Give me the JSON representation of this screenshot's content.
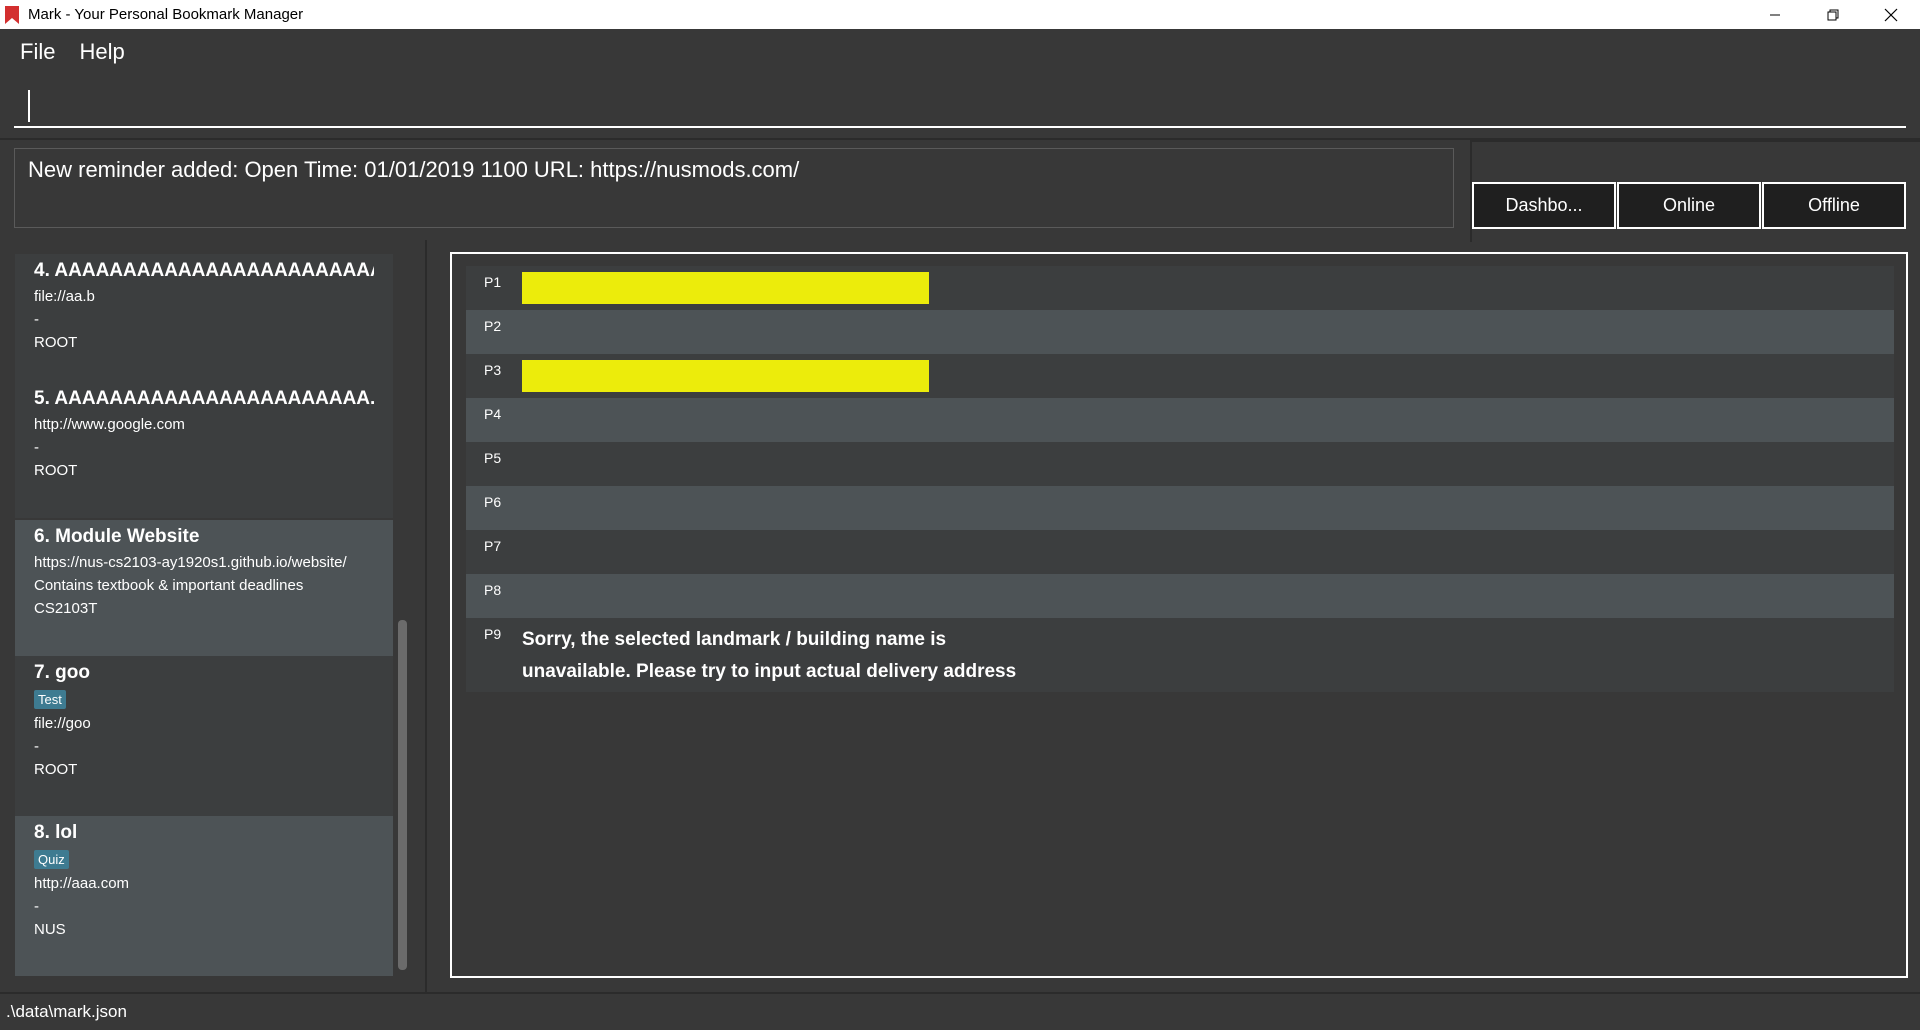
{
  "window": {
    "title": "Mark - Your Personal Bookmark Manager"
  },
  "menu": {
    "file": "File",
    "help": "Help"
  },
  "command": {
    "value": ""
  },
  "result": {
    "text": "New reminder added: Open Time: 01/01/2019 1100 URL: https://nusmods.com/"
  },
  "tabs": {
    "dashboard": "Dashbo...",
    "online": "Online",
    "offline": "Offline"
  },
  "bookmarks": [
    {
      "title": "4.  AAAAAAAAAAAAAAAAAAAAAAAA",
      "url": "file://aa.b",
      "remark": "-",
      "folder": "ROOT"
    },
    {
      "title": "5.  AAAAAAAAAAAAAAAAAAAAAAA...",
      "url": "http://www.google.com",
      "remark": "-",
      "folder": "ROOT"
    },
    {
      "title": "6.  Module Website",
      "url": "https://nus-cs2103-ay1920s1.github.io/website/",
      "remark": "Contains textbook & important deadlines",
      "folder": "CS2103T"
    },
    {
      "title": "7.  goo",
      "tag": "Test",
      "url": "file://goo",
      "remark": "-",
      "folder": "ROOT"
    },
    {
      "title": "8.  lol",
      "tag": "Quiz",
      "url": "http://aaa.com",
      "remark": "-",
      "folder": "NUS"
    }
  ],
  "rows": [
    {
      "label": "P1",
      "progress": 0.285
    },
    {
      "label": "P2"
    },
    {
      "label": "P3",
      "progress": 0.285
    },
    {
      "label": "P4"
    },
    {
      "label": "P5"
    },
    {
      "label": "P6"
    },
    {
      "label": "P7"
    },
    {
      "label": "P8"
    },
    {
      "label": "P9",
      "message_line1": "Sorry, the selected landmark / building name is",
      "message_line2": "unavailable. Please try to input actual delivery address"
    }
  ],
  "status": {
    "path": ".\\data\\mark.json"
  },
  "colors": {
    "bar": "#ecec0b",
    "tag": "#3e7b91",
    "app_icon": "#d32f2f"
  }
}
